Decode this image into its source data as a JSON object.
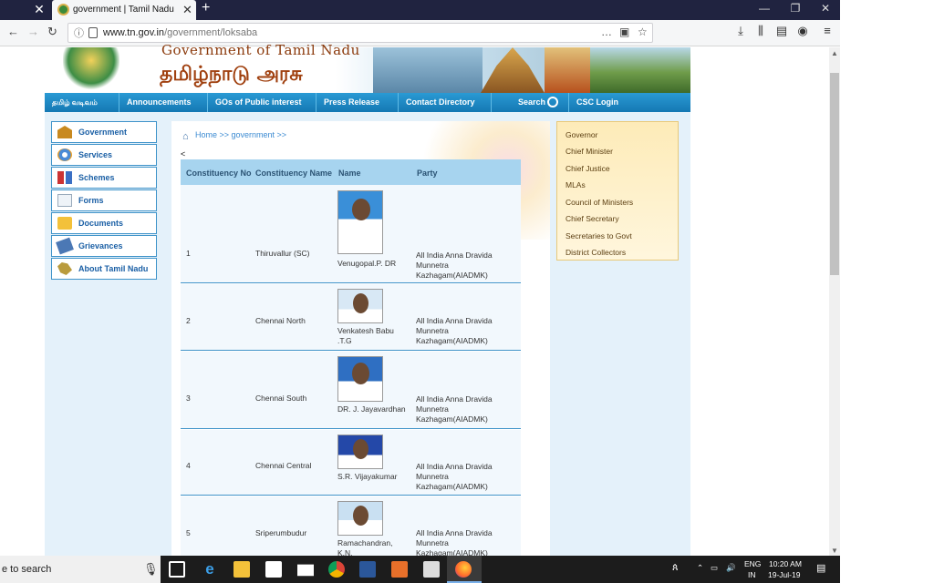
{
  "browser": {
    "tab_title": "government | Tamil Nadu Gove",
    "url_domain": "www.tn.gov.in",
    "url_path": "/government/loksaba",
    "more_icon": "…"
  },
  "site": {
    "gov_en": "Government of Tamil Nadu",
    "gov_ta": "தமிழ்நாடு அரசு",
    "menu": [
      "தமிழ் வடிவம்",
      "Announcements",
      "GOs of Public interest",
      "Press Release",
      "Contact Directory",
      "Search",
      "CSC Login"
    ],
    "left_nav": [
      "Government",
      "Services",
      "Schemes",
      "Forms",
      "Documents",
      "Grievances",
      "About Tamil Nadu"
    ],
    "breadcrumb": "Home >> government >>",
    "back_mark": "<",
    "table_headers": [
      "Constituency No",
      "Constituency Name",
      "Name",
      "Party"
    ],
    "rows": [
      {
        "no": "1",
        "constituency": "Thiruvallur (SC)",
        "name": "Venugopal.P. DR",
        "party": "All India Anna Dravida Munnetra Kazhagam(AIADMK)"
      },
      {
        "no": "2",
        "constituency": "Chennai North",
        "name": "Venkatesh Babu .T.G",
        "party": "All India Anna Dravida Munnetra Kazhagam(AIADMK)"
      },
      {
        "no": "3",
        "constituency": "Chennai South",
        "name": "DR. J. Jayavardhan",
        "party": "All India Anna Dravida Munnetra Kazhagam(AIADMK)"
      },
      {
        "no": "4",
        "constituency": "Chennai Central",
        "name": "S.R. Vijayakumar",
        "party": "All India Anna Dravida Munnetra Kazhagam(AIADMK)"
      },
      {
        "no": "5",
        "constituency": "Sriperumbudur",
        "name": "Ramachandran, K.N.",
        "party": "All India Anna Dravida Munnetra Kazhagam(AIADMK)"
      }
    ],
    "right_links": [
      "Governor",
      "Chief Minister",
      "Chief Justice",
      "MLAs",
      "Council of Ministers",
      "Chief Secretary",
      "Secretaries to Govt",
      "District Collectors"
    ]
  },
  "taskbar": {
    "search_text": "e to search",
    "lang": "ENG",
    "region": "IN",
    "time": "10:20 AM",
    "date": "19-Jul-19"
  },
  "colors": {
    "menu_blue": "#1a8bc9",
    "link_blue": "#1a5fa5",
    "header_brown": "#a0400f",
    "panel_bg": "#e4f1fa"
  }
}
